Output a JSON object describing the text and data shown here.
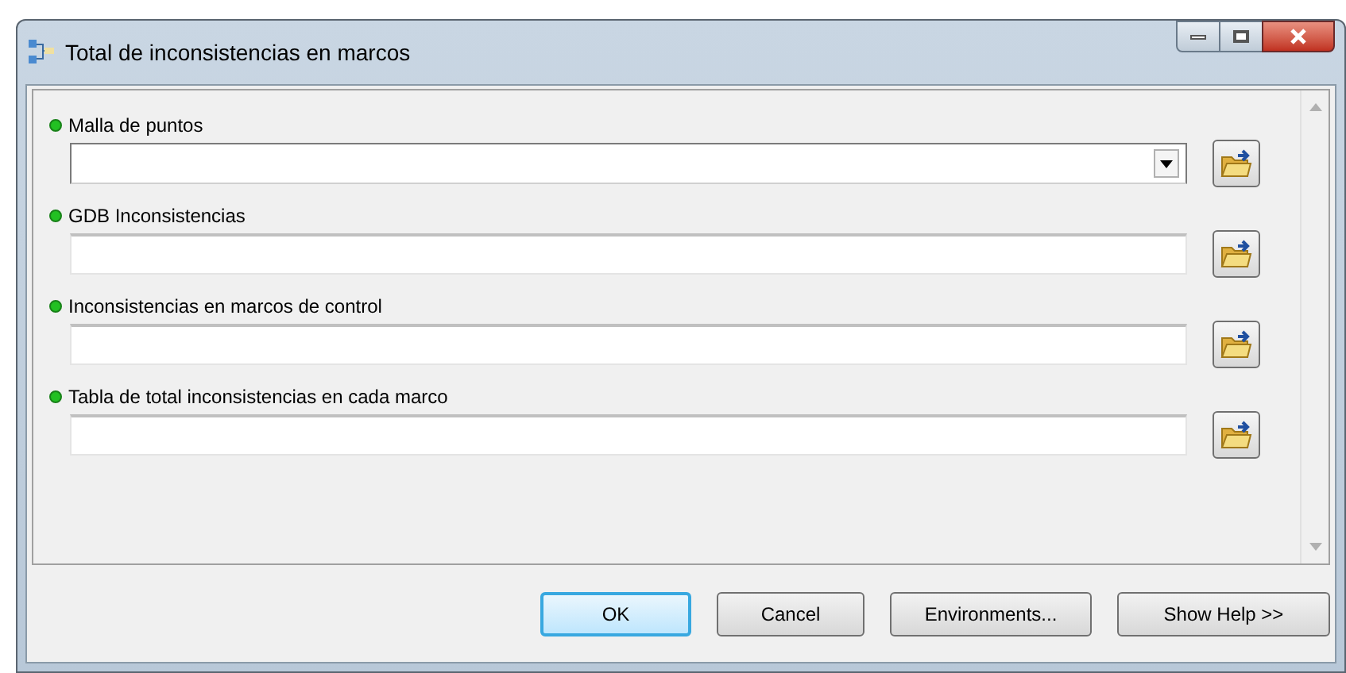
{
  "window": {
    "title": "Total de inconsistencias en marcos"
  },
  "parameters": [
    {
      "label": "Malla de puntos",
      "kind": "combo"
    },
    {
      "label": "GDB Inconsistencias",
      "kind": "text"
    },
    {
      "label": "Inconsistencias en marcos de control",
      "kind": "text"
    },
    {
      "label": "Tabla de total inconsistencias en cada marco",
      "kind": "text"
    }
  ],
  "buttons": [
    {
      "label": "OK",
      "default": true
    },
    {
      "label": "Cancel",
      "default": false
    },
    {
      "label": "Environments...",
      "default": false
    },
    {
      "label": "Show Help >>",
      "default": false
    }
  ]
}
